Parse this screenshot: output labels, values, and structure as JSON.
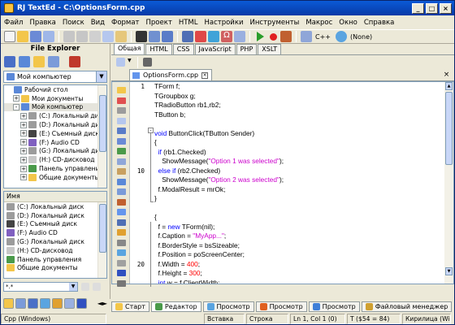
{
  "title": "RJ TextEd - C:\\OptionsForm.cpp",
  "menu": [
    "Файл",
    "Правка",
    "Поиск",
    "Вид",
    "Формат",
    "Проект",
    "HTML",
    "Настройки",
    "Инструменты",
    "Макрос",
    "Окно",
    "Справка"
  ],
  "toolbar": {
    "lang": "C++",
    "encoding": "(None)"
  },
  "file_explorer": {
    "title": "File Explorer",
    "location": "Мой компьютер",
    "tree": [
      {
        "label": "Рабочий стол",
        "level": 0,
        "exp": ""
      },
      {
        "label": "Мои документы",
        "level": 1,
        "exp": "+"
      },
      {
        "label": "Мой компьютер",
        "level": 1,
        "exp": "-"
      },
      {
        "label": "(C:) Локальный диск",
        "level": 2,
        "exp": "+"
      },
      {
        "label": "(D:) Локальный диск",
        "level": 2,
        "exp": "+"
      },
      {
        "label": "(E:) Съемный диск",
        "level": 2,
        "exp": "+"
      },
      {
        "label": "(F:) Audio CD",
        "level": 2,
        "exp": "+"
      },
      {
        "label": "(G:) Локальный диск",
        "level": 2,
        "exp": "+"
      },
      {
        "label": "(H:) CD-дисковод",
        "level": 2,
        "exp": "+"
      },
      {
        "label": "Панель управления",
        "level": 2,
        "exp": "+"
      },
      {
        "label": "Общие документы",
        "level": 2,
        "exp": "+"
      }
    ],
    "list_header": "Имя",
    "list": [
      "(C:) Локальный диск",
      "(D:) Локальный диск",
      "(E:) Съемный диск",
      "(F:) Audio CD",
      "(G:) Локальный диск",
      "(H:) CD-дисковод",
      "Панель управления",
      "Общие документы"
    ],
    "filter": "*.*"
  },
  "format_tabs": [
    "Общая",
    "HTML",
    "CSS",
    "JavaScript",
    "PHP",
    "XSLT"
  ],
  "doc_tab": "OptionsForm.cpp",
  "line_numbers": [
    "1",
    "",
    "",
    "",
    "",
    "",
    "",
    "",
    "",
    "10",
    "",
    "",
    "",
    "",
    "",
    "",
    "",
    "",
    "",
    "20",
    "",
    "",
    "",
    ""
  ],
  "code_lines": [
    [
      [
        "blk",
        "TForm f;"
      ]
    ],
    [
      [
        "blk",
        "TGroupbox g;"
      ]
    ],
    [
      [
        "blk",
        "TRadioButton rb1,rb2;"
      ]
    ],
    [
      [
        "blk",
        "TButton b;"
      ]
    ],
    [
      [
        "blk",
        ""
      ]
    ],
    [
      [
        "kw",
        "void "
      ],
      [
        "blk",
        "ButtonClick(TButton Sender)"
      ]
    ],
    [
      [
        "blk",
        "{"
      ]
    ],
    [
      [
        "blk",
        "  "
      ],
      [
        "kw",
        "if "
      ],
      [
        "blk",
        "(rb1.Checked)"
      ]
    ],
    [
      [
        "blk",
        "    ShowMessage("
      ],
      [
        "str",
        "\"Option 1 was selected\""
      ],
      [
        "blk",
        ");"
      ]
    ],
    [
      [
        "blk",
        "  "
      ],
      [
        "kw",
        "else if "
      ],
      [
        "blk",
        "(rb2.Checked)"
      ]
    ],
    [
      [
        "blk",
        "    ShowMessage("
      ],
      [
        "str",
        "\"Option 2 was selected\""
      ],
      [
        "blk",
        ");"
      ]
    ],
    [
      [
        "blk",
        "  f.ModalResult = mrOk;"
      ]
    ],
    [
      [
        "blk",
        "}"
      ]
    ],
    [
      [
        "blk",
        ""
      ]
    ],
    [
      [
        "blk",
        "{"
      ]
    ],
    [
      [
        "blk",
        "  f = "
      ],
      [
        "kw",
        "new "
      ],
      [
        "blk",
        "TForm(nil);"
      ]
    ],
    [
      [
        "blk",
        "  f.Caption = "
      ],
      [
        "str",
        "\"MyApp...\""
      ],
      [
        "blk",
        ";"
      ]
    ],
    [
      [
        "blk",
        "  f.BorderStyle = bsSizeable;"
      ]
    ],
    [
      [
        "blk",
        "  f.Position = poScreenCenter;"
      ]
    ],
    [
      [
        "blk",
        "  f.Width = "
      ],
      [
        "num",
        "400"
      ],
      [
        "blk",
        ";"
      ]
    ],
    [
      [
        "blk",
        "  f.Height = "
      ],
      [
        "num",
        "300"
      ],
      [
        "blk",
        ";"
      ]
    ],
    [
      [
        "kw",
        "  int "
      ],
      [
        "blk",
        "w = f.ClientWidth;"
      ]
    ],
    [
      [
        "kw",
        "  int "
      ],
      [
        "blk",
        "h = f.ClientHeight;"
      ]
    ],
    [
      [
        "blk",
        ""
      ]
    ]
  ],
  "bottom_tabs": [
    "Старт",
    "Редактор",
    "Просмотр",
    "Просмотр",
    "Просмотр",
    "Файловый менеджер"
  ],
  "status": {
    "lang": "Cpp (Windows)",
    "mode": "Вставка",
    "line": "Строка",
    "pos": "Ln 1, Col 1 (0)",
    "char": "T ($54 = 84)",
    "enc": "Кирилица (Wi"
  },
  "colors": {
    "keyword": "#0000ff",
    "string": "#cc00cc",
    "number": "#ff0000",
    "title": "#0a5ad6"
  }
}
